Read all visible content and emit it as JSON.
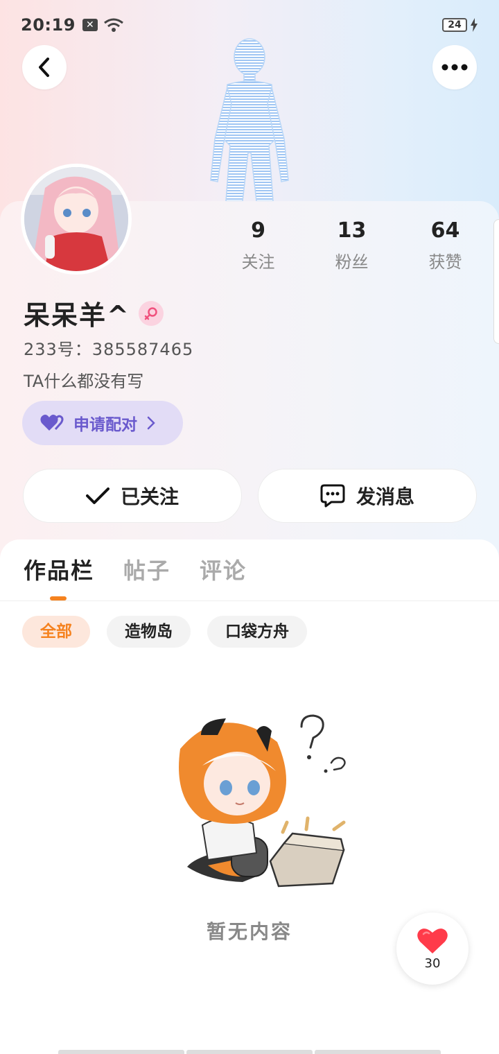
{
  "status_bar": {
    "time": "20:19",
    "battery": "24"
  },
  "stats": [
    {
      "count": "9",
      "label": "关注"
    },
    {
      "count": "13",
      "label": "粉丝"
    },
    {
      "count": "64",
      "label": "获赞"
    }
  ],
  "profile": {
    "username": "呆呆羊^",
    "uid": "233号：385587465",
    "bio": "TA什么都没有写",
    "pair_label": "申请配对"
  },
  "actions": {
    "follow_label": "已关注",
    "message_label": "发消息"
  },
  "tabs": [
    {
      "label": "作品栏"
    },
    {
      "label": "帖子"
    },
    {
      "label": "评论"
    }
  ],
  "filters": [
    {
      "label": "全部"
    },
    {
      "label": "造物岛"
    },
    {
      "label": "口袋方舟"
    }
  ],
  "empty": {
    "text": "暂无内容"
  },
  "like": {
    "count": "30"
  },
  "colors": {
    "accent": "#f5821f",
    "pair": "#6a5acd",
    "like": "#ff3b4a"
  }
}
